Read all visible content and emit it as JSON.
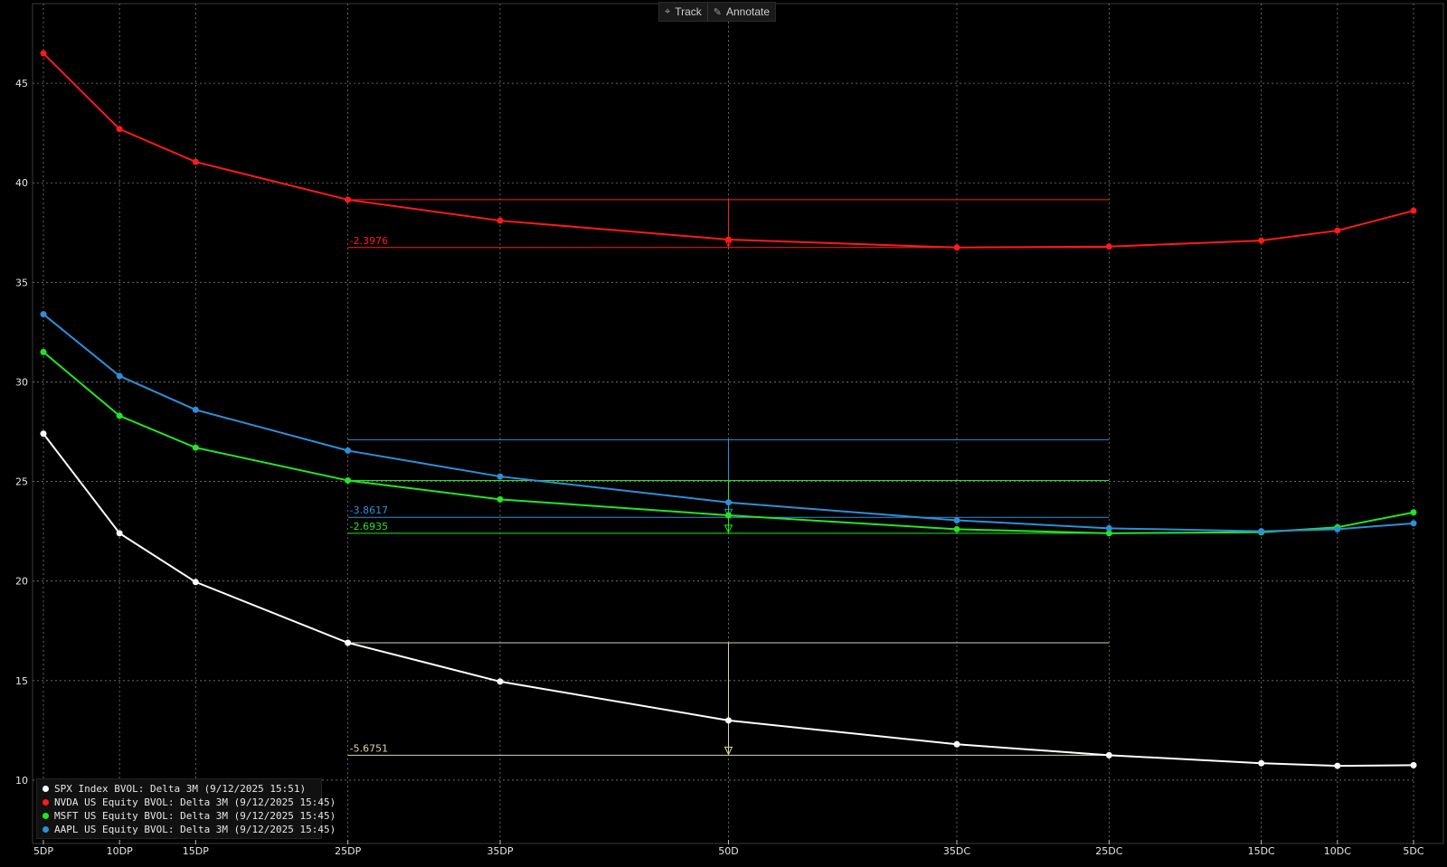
{
  "toolbar": {
    "track_label": "Track",
    "annotate_label": "Annotate"
  },
  "chart_data": {
    "type": "line",
    "categories": [
      "5DP",
      "10DP",
      "15DP",
      "25DP",
      "35DP",
      "50D",
      "35DC",
      "25DC",
      "15DC",
      "10DC",
      "5DC"
    ],
    "x_positions": [
      5,
      10,
      15,
      25,
      35,
      50,
      65,
      75,
      85,
      90,
      95
    ],
    "ylim": [
      7,
      49
    ],
    "yticks": [
      10,
      15,
      20,
      25,
      30,
      35,
      40,
      45
    ],
    "grid": true,
    "legend_position": "bottom-left",
    "series": [
      {
        "name": "SPX Index BVOL: Delta 3M (9/12/2025 15:51)",
        "color": "#ffffff",
        "values": [
          27.4,
          22.4,
          19.95,
          16.9,
          14.95,
          13.0,
          11.8,
          11.25,
          10.85,
          10.72,
          10.75
        ]
      },
      {
        "name": "NVDA US Equity BVOL: Delta 3M (9/12/2025 15:45)",
        "color": "#ff1a1a",
        "values": [
          46.5,
          42.7,
          41.05,
          39.15,
          38.1,
          37.15,
          36.75,
          36.8,
          37.1,
          37.6,
          38.6
        ]
      },
      {
        "name": "MSFT US Equity BVOL: Delta 3M (9/12/2025 15:45)",
        "color": "#22e622",
        "values": [
          31.5,
          28.3,
          26.7,
          25.05,
          24.1,
          23.3,
          22.6,
          22.4,
          22.45,
          22.7,
          23.45
        ]
      },
      {
        "name": "AAPL US Equity BVOL: Delta 3M (9/12/2025 15:45)",
        "color": "#2d8fd8",
        "values": [
          33.4,
          30.3,
          28.6,
          26.55,
          25.25,
          23.95,
          23.05,
          22.65,
          22.5,
          22.6,
          22.9
        ]
      }
    ],
    "annotations": [
      {
        "series": "NVDA US Equity BVOL: Delta 3M (9/12/2025 15:45)",
        "color": "#ff1a1a",
        "label": "-2.3976",
        "from": 39.15,
        "to": 36.75
      },
      {
        "series": "AAPL US Equity BVOL: Delta 3M (9/12/2025 15:45)",
        "color": "#2d8fd8",
        "label": "-3.8617",
        "from": 27.1,
        "to": 23.2
      },
      {
        "series": "MSFT US Equity BVOL: Delta 3M (9/12/2025 15:45)",
        "color": "#22e622",
        "label": "-2.6935",
        "from": 25.05,
        "to": 22.4
      },
      {
        "series": "SPX Index BVOL: Delta 3M (9/12/2025 15:51)",
        "color": "#d8d6a0",
        "label": "-5.6751",
        "from": 16.9,
        "to": 11.25
      }
    ]
  }
}
